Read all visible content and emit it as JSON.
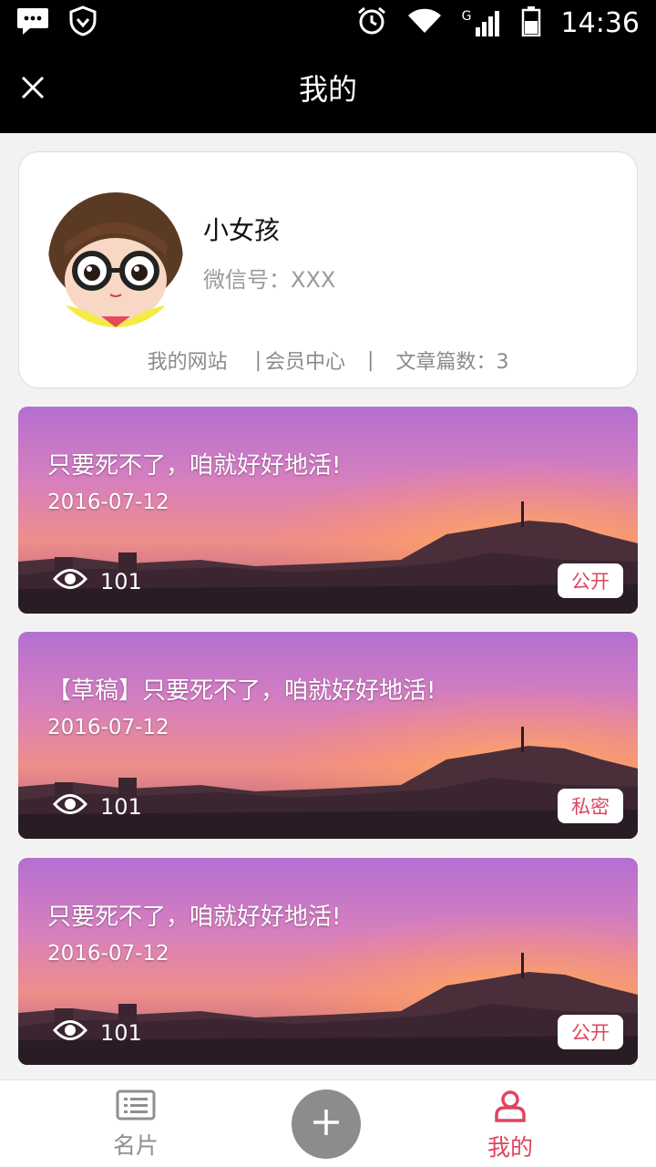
{
  "status_bar": {
    "time": "14:36",
    "network_type": "G",
    "icons": [
      "message-icon",
      "shield-icon",
      "alarm-icon",
      "wifi-icon",
      "signal-icon",
      "battery-icon"
    ]
  },
  "nav": {
    "title": "我的",
    "close_icon": "close-icon"
  },
  "profile": {
    "name": "小女孩",
    "wechat": "微信号：XXX",
    "links": {
      "website": "我的网站",
      "separator": "|",
      "member_center": "会员中心",
      "article_count": "文章篇数：3"
    }
  },
  "articles": [
    {
      "title": "只要死不了，咱就好好地活!",
      "date": "2016-07-12",
      "views": "101",
      "badge": "公开"
    },
    {
      "title": "【草稿】只要死不了，咱就好好地活!",
      "date": "2016-07-12",
      "views": "101",
      "badge": "私密"
    },
    {
      "title": "只要死不了，咱就好好地活!",
      "date": "2016-07-12",
      "views": "101",
      "badge": "公开"
    }
  ],
  "tabs": {
    "cards_label": "名片",
    "mine_label": "我的",
    "add_icon": "plus-icon"
  },
  "colors": {
    "accent": "#e0455e",
    "header_bg": "#000000",
    "page_bg": "#f2f2f2"
  }
}
